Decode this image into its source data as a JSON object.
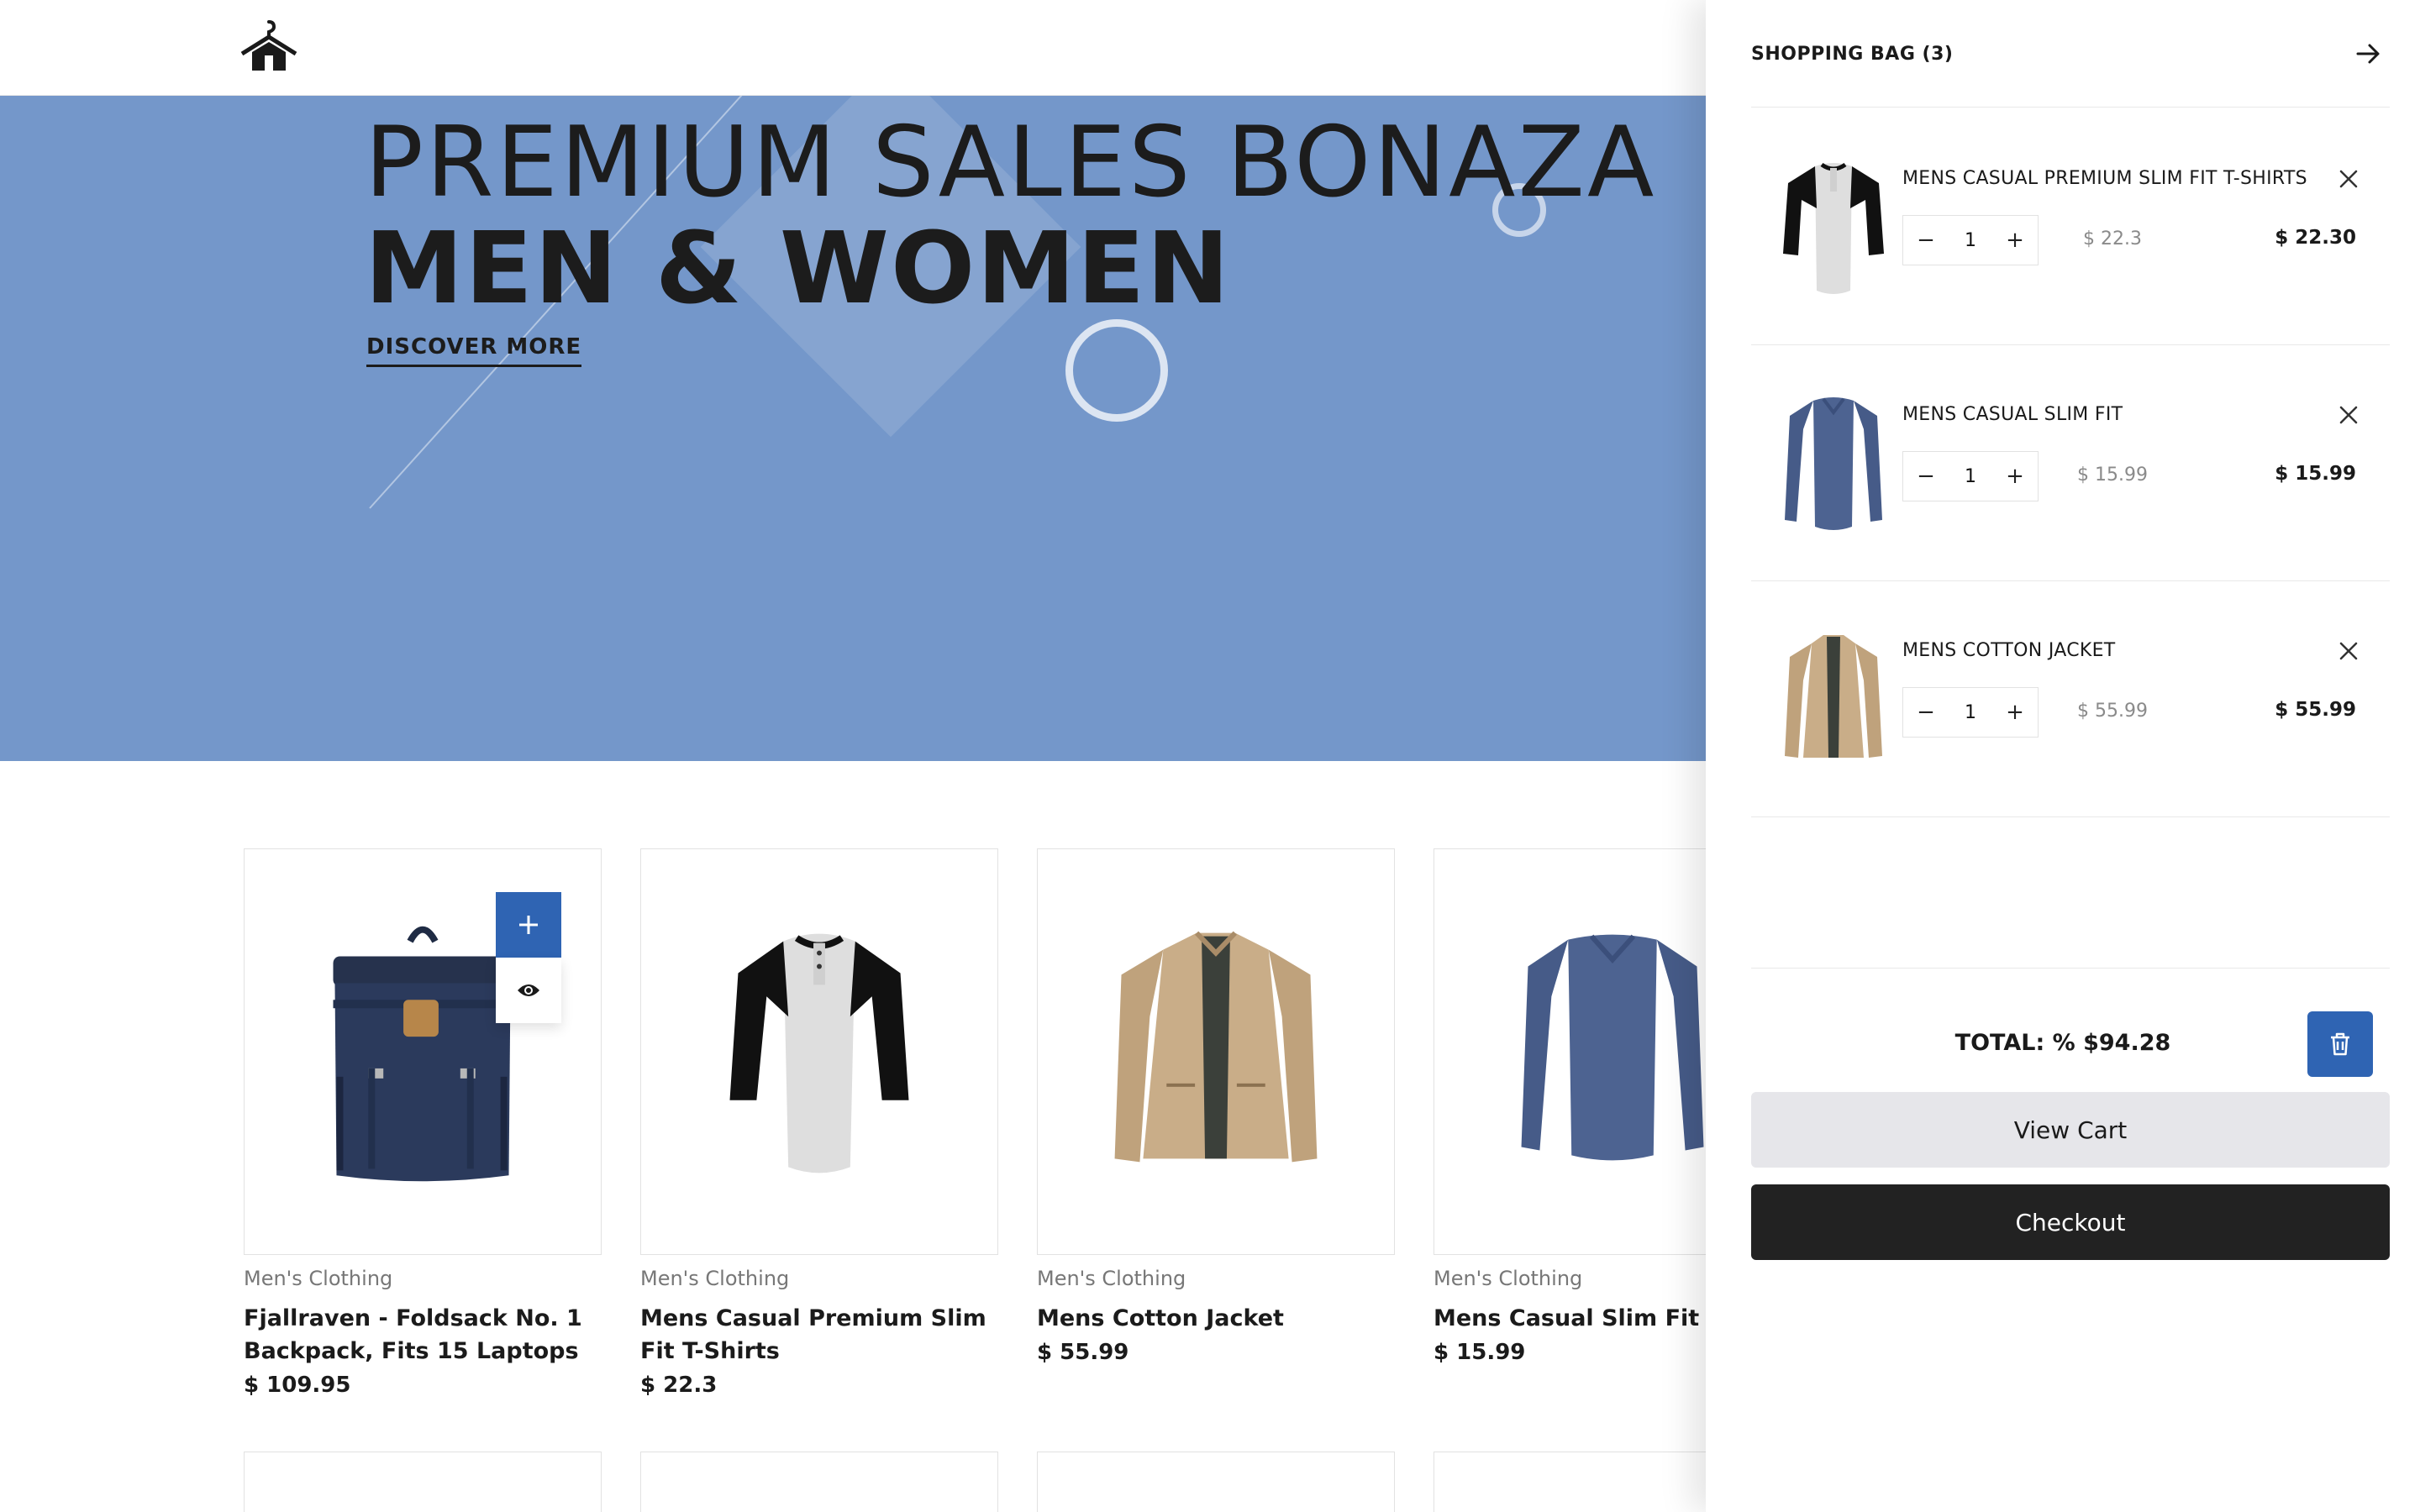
{
  "header": {
    "logo_icon": "hanger-house-logo"
  },
  "hero": {
    "title_line1": "PREMIUM SALES BONAZA",
    "title_line2": "MEN & WOMEN",
    "cta_label": "DISCOVER MORE",
    "background": "#7497ca"
  },
  "products": [
    {
      "category": "Men's Clothing",
      "name": "Fjallraven - Foldsack No. 1 Backpack, Fits 15 Laptops",
      "price": "$ 109.95",
      "icon": "backpack-image"
    },
    {
      "category": "Men's Clothing",
      "name": "Mens Casual Premium Slim Fit T-Shirts",
      "price": "$ 22.3",
      "icon": "raglan-tshirt-image"
    },
    {
      "category": "Men's Clothing",
      "name": "Mens Cotton Jacket",
      "price": "$ 55.99",
      "icon": "cotton-jacket-image"
    },
    {
      "category": "Men's Clothing",
      "name": "Mens Casual Slim Fit",
      "price": "$ 15.99",
      "icon": "longsleeve-tee-image"
    }
  ],
  "product_actions": {
    "add_icon": "plus-icon",
    "view_icon": "eye-icon"
  },
  "cart": {
    "title": "SHOPPING BAG (3)",
    "close_icon": "arrow-right-icon",
    "items": [
      {
        "name": "MENS CASUAL PREMIUM SLIM FIT T-SHIRTS",
        "quantity": "1",
        "unit_price": "$ 22.3",
        "line_total": "$ 22.30"
      },
      {
        "name": "MENS CASUAL SLIM FIT",
        "quantity": "1",
        "unit_price": "$ 15.99",
        "line_total": "$ 15.99"
      },
      {
        "name": "MENS COTTON JACKET",
        "quantity": "1",
        "unit_price": "$ 55.99",
        "line_total": "$ 55.99"
      }
    ],
    "qty_minus": "−",
    "qty_plus": "+",
    "total_text": "TOTAL:  % $94.28",
    "clear_icon": "trash-icon",
    "view_cart_label": "View Cart",
    "checkout_label": "Checkout",
    "accent": "#2f64b3"
  }
}
